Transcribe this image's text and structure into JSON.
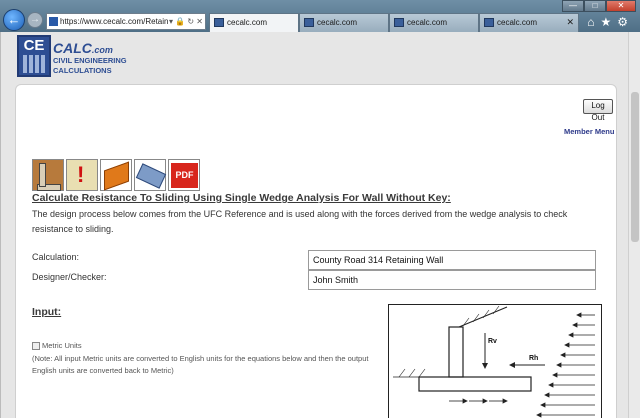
{
  "browser": {
    "back_icon": "back-arrow-icon",
    "forward_icon": "forward-arrow-icon",
    "url": "https://www.cecalc.com/Retain",
    "tabs": [
      {
        "label": "cecalc.com"
      },
      {
        "label": "cecalc.com"
      },
      {
        "label": "cecalc.com"
      },
      {
        "label": "cecalc.com"
      }
    ]
  },
  "logo": {
    "ce": "CE",
    "calc": "CALC",
    "com": ".com",
    "line1": "CIVIL ENGINEERING",
    "line2": "CALCULATIONS"
  },
  "header": {
    "logout_label": "Log Out",
    "member_menu": "Member Menu"
  },
  "toolbar_icons": [
    "wall-icon",
    "warning-icon",
    "book-icon",
    "print-icon",
    "pdf-icon"
  ],
  "pdf_label": "PDF",
  "page": {
    "title": "Calculate Resistance To Sliding Using Single Wedge Analysis For Wall Without Key:",
    "description": "The design process below comes from the UFC Reference and is used along with the forces derived from the wedge analysis to check resistance to sliding."
  },
  "form": {
    "calculation_label": "Calculation:",
    "calculation_value": "County Road 314 Retaining Wall",
    "designer_label": "Designer/Checker:",
    "designer_value": "John Smith"
  },
  "input_section": {
    "heading": "Input:",
    "metric_label": "Metric Units",
    "metric_checked": false,
    "note": "(Note: All input Metric units are converted to English units for the equations below and then the output English units are converted back to Metric)"
  },
  "diagram": {
    "rv_label": "Rv",
    "rh_label": "Rh"
  },
  "colors": {
    "brand": "#2e4e93",
    "title_text": "#3a3a3a"
  }
}
